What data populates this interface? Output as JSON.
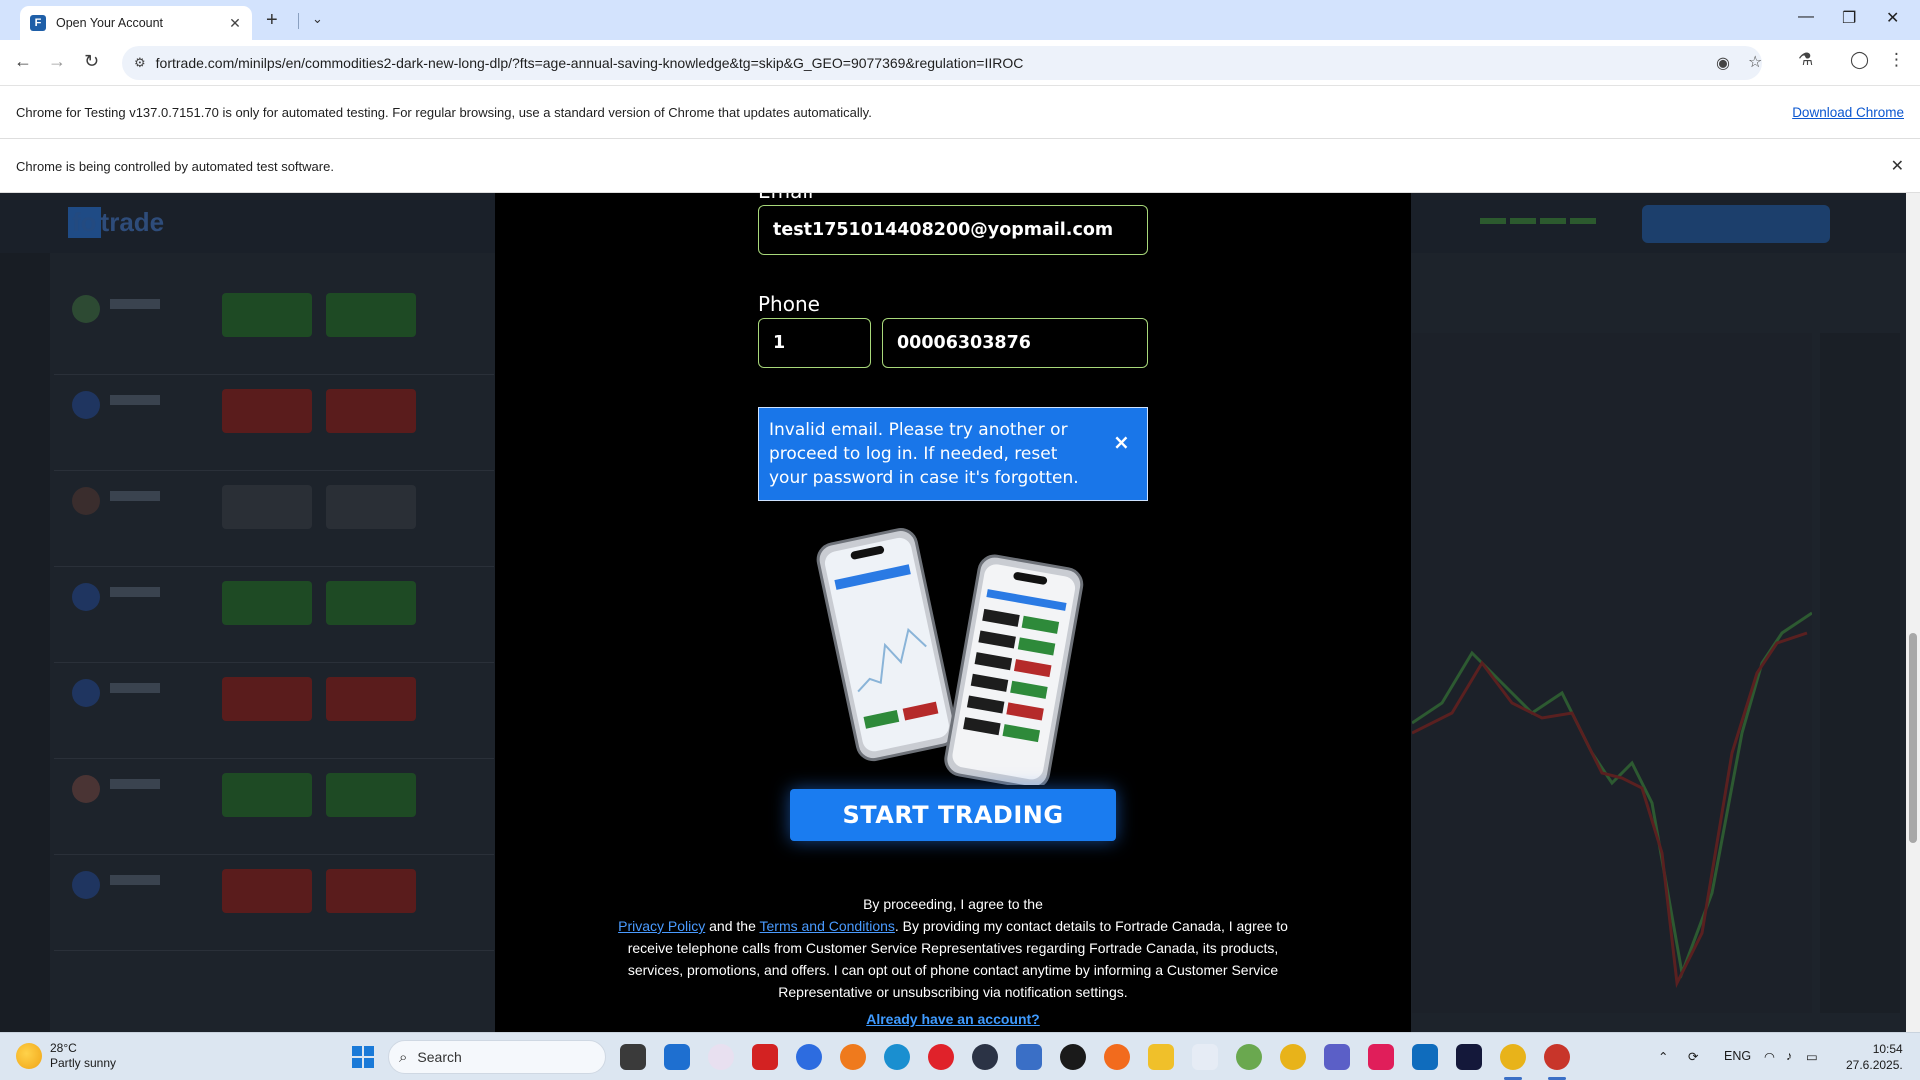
{
  "browser": {
    "tab_title": "Open Your Account",
    "favicon_letter": "F",
    "url": "fortrade.com/minilps/en/commodities2-dark-new-long-dlp/?fts=age-annual-saving-knowledge&tg=skip&G_GEO=9077369&regulation=IIROC",
    "testing_notice": "Chrome for Testing v137.0.7151.70 is only for automated testing. For regular browsing, use a standard version of Chrome that updates automatically.",
    "download_link": "Download Chrome",
    "automation_notice": "Chrome is being controlled by automated test software."
  },
  "form": {
    "email_label": "Email",
    "email_value": "test1751014408200@yopmail.com",
    "phone_label": "Phone",
    "phone_code": "1",
    "phone_number": "00006303876",
    "error_message": "Invalid email. Please try another or proceed to log in. If needed, reset your password in case it's forgotten.",
    "error_close": "×",
    "submit_label": "START TRADING"
  },
  "legal": {
    "intro": "By proceeding, I agree to the",
    "privacy": "Privacy Policy",
    "and_the": " and the ",
    "terms": "Terms and Conditions",
    "rest": ". By providing my contact details to Fortrade Canada, I agree to receive telephone calls from Customer Service Representatives regarding Fortrade Canada, its products, services, promotions, and offers. I can opt out of phone contact anytime by informing a Customer Service Representative or unsubscribing via notification settings.",
    "already": "Already have an account?"
  },
  "taskbar": {
    "temperature": "28°C",
    "weather": "Partly sunny",
    "search_placeholder": "Search",
    "language": "ENG",
    "time": "10:54",
    "date": "27.6.2025."
  },
  "colors": {
    "accent": "#1a7cf0",
    "field_border": "#a8d87a",
    "alert_bg": "#1976e9"
  }
}
